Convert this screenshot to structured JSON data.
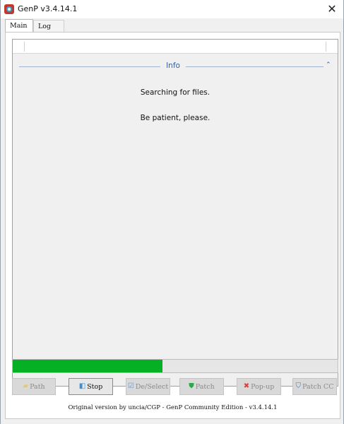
{
  "window": {
    "title": "GenP v3.4.14.1",
    "close_glyph": "✕"
  },
  "tabs": [
    {
      "label": "Main",
      "active": true
    },
    {
      "label": "Log",
      "active": false
    }
  ],
  "group": {
    "title": "Info",
    "collapse_glyph": "⌃"
  },
  "messages": [
    "Searching for files.",
    "Be patient, please."
  ],
  "progress": {
    "value": 0.46,
    "color": "#06b025"
  },
  "buttons": [
    {
      "label": "Path",
      "icon": "folder-icon",
      "enabled": false
    },
    {
      "label": "Stop",
      "icon": "stop-icon",
      "enabled": true
    },
    {
      "label": "De/Select",
      "icon": "deselect-icon",
      "enabled": false
    },
    {
      "label": "Patch",
      "icon": "shield-check-icon",
      "enabled": false
    },
    {
      "label": "Pop-up",
      "icon": "popup-block-icon",
      "enabled": false
    },
    {
      "label": "Patch CC",
      "icon": "shield-icon",
      "enabled": false
    }
  ],
  "footer": "Original version by uncia/CGP - GenP Community Edition - v3.4.14.1"
}
